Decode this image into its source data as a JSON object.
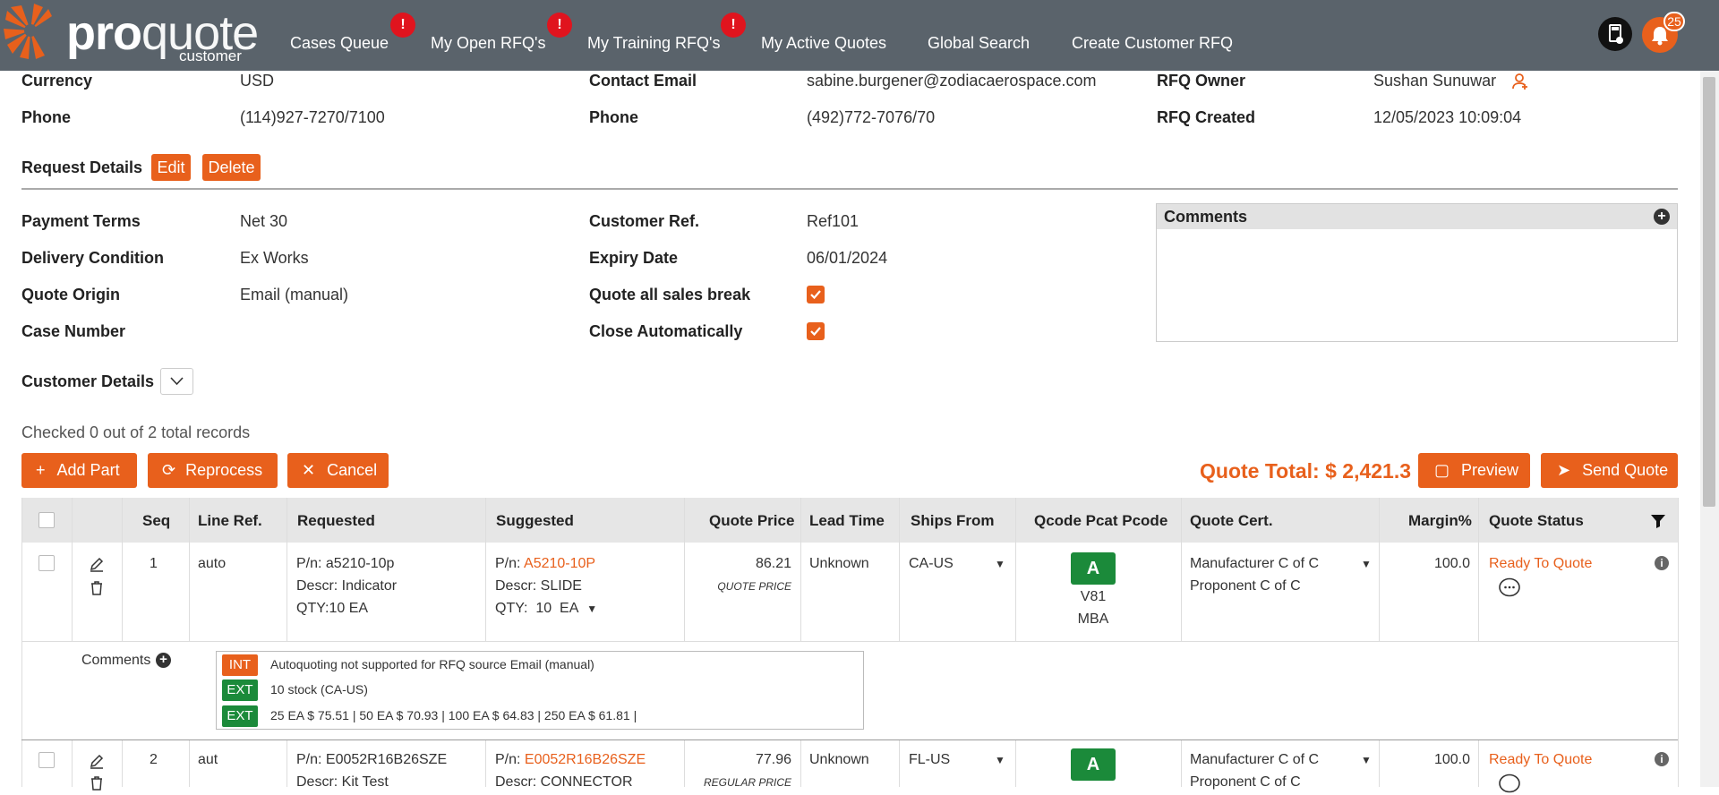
{
  "brand": {
    "word_bold": "pro",
    "word_light": "quote",
    "sub": "customer"
  },
  "nav": {
    "cases": "Cases Queue",
    "open": "My Open RFQ's",
    "training": "My Training RFQ's",
    "active": "My Active Quotes",
    "search": "Global Search",
    "create": "Create Customer RFQ",
    "alert_glyph": "!"
  },
  "notifications": {
    "count": "25"
  },
  "info": {
    "currency_label": "Currency",
    "currency": "USD",
    "phone_label": "Phone",
    "phone": "(114)927-7270/7100",
    "contact_email_label": "Contact Email",
    "contact_email": "sabine.burgener@zodiacaerospace.com",
    "phone2_label": "Phone",
    "phone2": "(492)772-7076/70",
    "owner_label": "RFQ Owner",
    "owner": "Sushan Sunuwar",
    "created_label": "RFQ Created",
    "created": "12/05/2023 10:09:04"
  },
  "request": {
    "title": "Request Details",
    "edit": "Edit",
    "delete": "Delete",
    "payment_label": "Payment Terms",
    "payment": "Net 30",
    "delivery_label": "Delivery Condition",
    "delivery": "Ex Works",
    "origin_label": "Quote Origin",
    "origin": "Email (manual)",
    "case_label": "Case Number",
    "case": "",
    "custref_label": "Customer Ref.",
    "custref": "Ref101",
    "expiry_label": "Expiry Date",
    "expiry": "06/01/2024",
    "salesbreak_label": "Quote all sales break",
    "salesbreak_checked": true,
    "autoclose_label": "Close Automatically",
    "autoclose_checked": true,
    "comments_title": "Comments"
  },
  "customer_details": "Customer Details",
  "records_text": "Checked 0 out of 2 total records",
  "actions": {
    "add": "Add Part",
    "reprocess": "Reprocess",
    "cancel": "Cancel",
    "preview": "Preview",
    "send": "Send Quote",
    "total": "Quote Total: $ 2,421.3"
  },
  "table": {
    "headers": {
      "seq": "Seq",
      "lineref": "Line Ref.",
      "requested": "Requested",
      "suggested": "Suggested",
      "price": "Quote Price",
      "lead": "Lead Time",
      "ships": "Ships From",
      "qcode": "Qcode Pcat Pcode",
      "cert": "Quote Cert.",
      "margin": "Margin%",
      "status": "Quote Status"
    },
    "rows": [
      {
        "seq": "1",
        "lineref": "auto",
        "req_pn": "P/n: a5210-10p",
        "req_descr": "Descr: Indicator",
        "req_qty": "QTY:10 EA",
        "sug_pn_label": "P/n: ",
        "sug_pn": "A5210-10P",
        "sug_descr": "Descr: SLIDE",
        "sug_qty_label": "QTY:",
        "sug_qty": "10",
        "sug_uom": "EA",
        "price": "86.21",
        "price_type": "QUOTE PRICE",
        "lead": "Unknown",
        "ships": "CA-US",
        "qcode": "A",
        "pcat": "V81",
        "pcode": "MBA",
        "cert1": "Manufacturer C of C",
        "cert2": "Proponent C of C",
        "margin": "100.0",
        "status": "Ready To Quote"
      },
      {
        "seq": "2",
        "lineref": "aut",
        "req_pn": "P/n: E0052R16B26SZE",
        "req_descr": "Descr: Kit Test",
        "sug_pn_label": "P/n: ",
        "sug_pn": "E0052R16B26SZE",
        "sug_descr": "Descr: CONNECTOR",
        "price": "77.96",
        "price_type": "REGULAR PRICE",
        "lead": "Unknown",
        "ships": "FL-US",
        "qcode": "A",
        "cert1": "Manufacturer C of C",
        "cert2": "Proponent C of C",
        "margin": "100.0",
        "status": "Ready To Quote"
      }
    ],
    "comments_label": "Comments",
    "comment_lines": [
      {
        "tag": "INT",
        "color": "#e8601c",
        "text": "Autoquoting not supported for RFQ source Email (manual)"
      },
      {
        "tag": "EXT",
        "color": "#1b8a3a",
        "text": "10 stock (CA-US)"
      },
      {
        "tag": "EXT",
        "color": "#1b8a3a",
        "text": "25 EA $ 75.51 | 50 EA $ 70.93 | 100 EA $ 64.83 | 250 EA $ 61.81 |"
      }
    ]
  },
  "colors": {
    "accent": "#e8601c",
    "header": "#5a636b",
    "green": "#1b8a3a"
  }
}
